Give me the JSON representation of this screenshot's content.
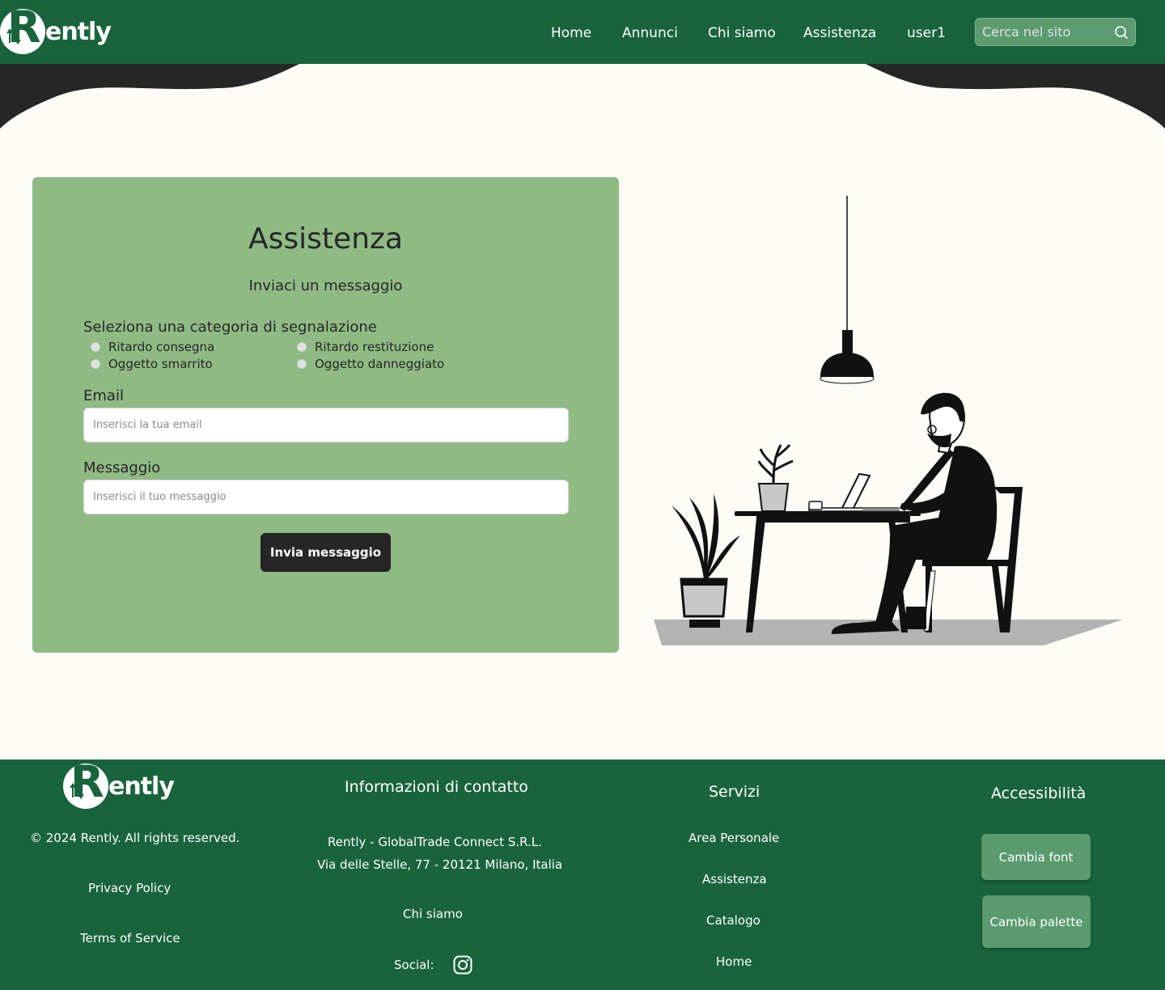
{
  "header": {
    "logo_text": "ently",
    "nav": [
      "Home",
      "Annunci",
      "Chi siamo",
      "Assistenza",
      "user1"
    ],
    "search_placeholder": "Cerca nel sito",
    "search_icon": "search-icon"
  },
  "form": {
    "title": "Assistenza",
    "subtitle": "Inviaci un messaggio",
    "category_label": "Seleziona una categoria di segnalazione",
    "categories": [
      "Ritardo consegna",
      "Ritardo restituzione",
      "Oggetto smarrito",
      "Oggetto danneggiato"
    ],
    "email_label": "Email",
    "email_placeholder": "Inserisci la tua email",
    "message_label": "Messaggio",
    "message_placeholder": "Inserisci il tuo messaggio",
    "submit_label": "Invia messaggio"
  },
  "footer": {
    "logo_text": "ently",
    "copyright": "© 2024 Rently. All rights reserved.",
    "privacy": "Privacy Policy",
    "terms": "Terms of Service",
    "contact_title": "Informazioni di contatto",
    "company": "Rently - GlobalTrade Connect S.R.L.",
    "address": "Via delle Stelle, 77 - 20121 Milano, Italia",
    "about": "Chi siamo",
    "social_label": "Social:",
    "services_title": "Servizi",
    "services": [
      "Area Personale",
      "Assistenza",
      "Catalogo",
      "Home"
    ],
    "accessibility_title": "Accessibilità",
    "font_button": "Cambia font",
    "palette_button": "Cambia palette"
  },
  "colors": {
    "brand_green": "#19643c",
    "card_green": "#8fba84",
    "dark": "#262626",
    "background": "#fdfcf7"
  }
}
